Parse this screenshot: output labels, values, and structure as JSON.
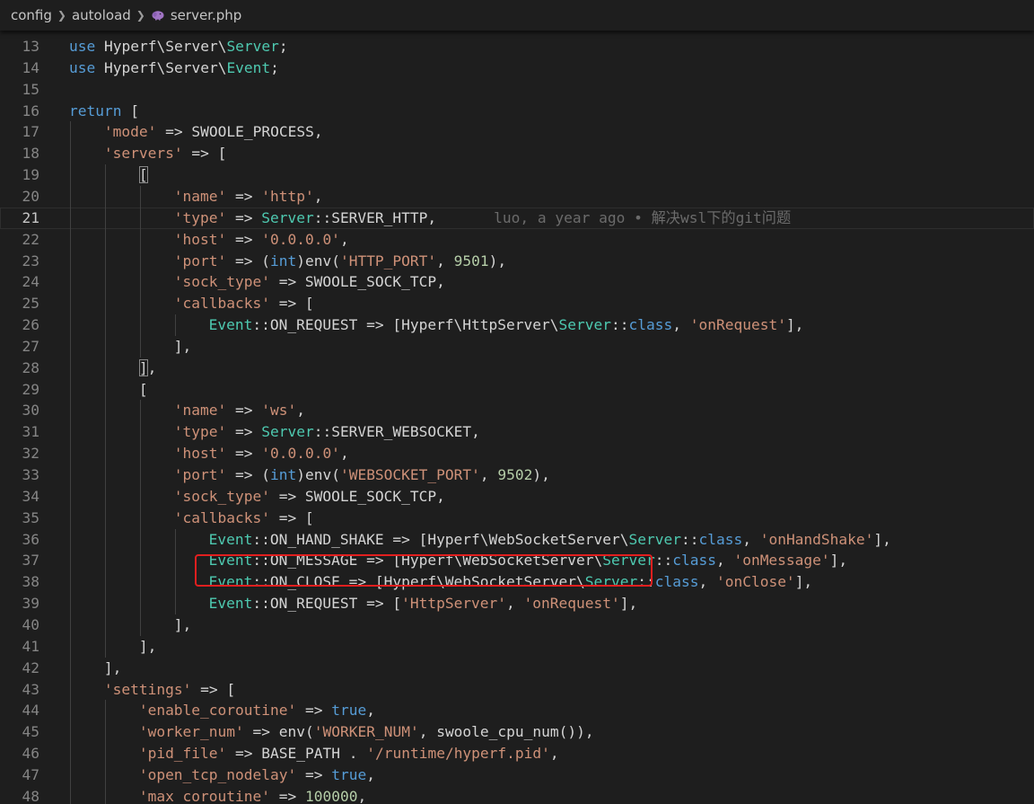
{
  "breadcrumb": {
    "items": [
      {
        "label": "config",
        "icon": null
      },
      {
        "label": "autoload",
        "icon": null
      },
      {
        "label": "server.php",
        "icon": "php-elephant-icon"
      }
    ],
    "separator_icon": "chevron-right-icon"
  },
  "colors": {
    "background": "#1e1e1e",
    "keyword": "#569cd6",
    "string": "#ce9178",
    "class": "#4ec9b0",
    "number": "#b5cea8",
    "plain": "#d4d4d4",
    "line_number": "#858585",
    "blame": "#6b6b6b",
    "annotation_box": "#e21f1f"
  },
  "editor": {
    "current_line": 21,
    "blame_annotation": {
      "line": 21,
      "text": "luo, a year ago • 解决wsl下的git问题"
    },
    "highlighted_line": 39,
    "lines": [
      {
        "n": "13",
        "indent": 0,
        "tokens": [
          [
            "kw",
            "use"
          ],
          [
            "p",
            " Hyperf\\Server\\"
          ],
          [
            "cls",
            "Server"
          ],
          [
            "p",
            ";"
          ]
        ]
      },
      {
        "n": "14",
        "indent": 0,
        "tokens": [
          [
            "kw",
            "use"
          ],
          [
            "p",
            " Hyperf\\Server\\"
          ],
          [
            "cls",
            "Event"
          ],
          [
            "p",
            ";"
          ]
        ]
      },
      {
        "n": "15",
        "indent": 0,
        "tokens": []
      },
      {
        "n": "16",
        "indent": 0,
        "tokens": [
          [
            "kw",
            "return"
          ],
          [
            "p",
            " ["
          ]
        ]
      },
      {
        "n": "17",
        "indent": 1,
        "tokens": [
          [
            "str",
            "'mode'"
          ],
          [
            "p",
            " => SWOOLE_PROCESS,"
          ]
        ]
      },
      {
        "n": "18",
        "indent": 1,
        "tokens": [
          [
            "str",
            "'servers'"
          ],
          [
            "p",
            " => ["
          ]
        ]
      },
      {
        "n": "19",
        "indent": 2,
        "tokens": [
          [
            "br",
            "["
          ]
        ]
      },
      {
        "n": "20",
        "indent": 3,
        "tokens": [
          [
            "str",
            "'name'"
          ],
          [
            "p",
            " => "
          ],
          [
            "str",
            "'http'"
          ],
          [
            "p",
            ","
          ]
        ]
      },
      {
        "n": "21",
        "indent": 3,
        "tokens": [
          [
            "str",
            "'type'"
          ],
          [
            "p",
            " => "
          ],
          [
            "cls",
            "Server"
          ],
          [
            "p",
            "::SERVER_HTTP,"
          ]
        ]
      },
      {
        "n": "22",
        "indent": 3,
        "tokens": [
          [
            "str",
            "'host'"
          ],
          [
            "p",
            " => "
          ],
          [
            "str",
            "'0.0.0.0'"
          ],
          [
            "p",
            ","
          ]
        ]
      },
      {
        "n": "23",
        "indent": 3,
        "tokens": [
          [
            "str",
            "'port'"
          ],
          [
            "p",
            " => ("
          ],
          [
            "kw",
            "int"
          ],
          [
            "p",
            ")env("
          ],
          [
            "str",
            "'HTTP_PORT'"
          ],
          [
            "p",
            ", "
          ],
          [
            "num",
            "9501"
          ],
          [
            "p",
            "),"
          ]
        ]
      },
      {
        "n": "24",
        "indent": 3,
        "tokens": [
          [
            "str",
            "'sock_type'"
          ],
          [
            "p",
            " => SWOOLE_SOCK_TCP,"
          ]
        ]
      },
      {
        "n": "25",
        "indent": 3,
        "tokens": [
          [
            "str",
            "'callbacks'"
          ],
          [
            "p",
            " => ["
          ]
        ]
      },
      {
        "n": "26",
        "indent": 4,
        "tokens": [
          [
            "cls",
            "Event"
          ],
          [
            "p",
            "::ON_REQUEST => [Hyperf\\HttpServer\\"
          ],
          [
            "cls",
            "Server"
          ],
          [
            "p",
            "::"
          ],
          [
            "kw",
            "class"
          ],
          [
            "p",
            ", "
          ],
          [
            "str",
            "'onRequest'"
          ],
          [
            "p",
            "],"
          ]
        ]
      },
      {
        "n": "27",
        "indent": 3,
        "tokens": [
          [
            "p",
            "],"
          ]
        ]
      },
      {
        "n": "28",
        "indent": 2,
        "tokens": [
          [
            "br",
            "]"
          ],
          [
            "p",
            ","
          ]
        ]
      },
      {
        "n": "29",
        "indent": 2,
        "tokens": [
          [
            "p",
            "["
          ]
        ]
      },
      {
        "n": "30",
        "indent": 3,
        "tokens": [
          [
            "str",
            "'name'"
          ],
          [
            "p",
            " => "
          ],
          [
            "str",
            "'ws'"
          ],
          [
            "p",
            ","
          ]
        ]
      },
      {
        "n": "31",
        "indent": 3,
        "tokens": [
          [
            "str",
            "'type'"
          ],
          [
            "p",
            " => "
          ],
          [
            "cls",
            "Server"
          ],
          [
            "p",
            "::SERVER_WEBSOCKET,"
          ]
        ]
      },
      {
        "n": "32",
        "indent": 3,
        "tokens": [
          [
            "str",
            "'host'"
          ],
          [
            "p",
            " => "
          ],
          [
            "str",
            "'0.0.0.0'"
          ],
          [
            "p",
            ","
          ]
        ]
      },
      {
        "n": "33",
        "indent": 3,
        "tokens": [
          [
            "str",
            "'port'"
          ],
          [
            "p",
            " => ("
          ],
          [
            "kw",
            "int"
          ],
          [
            "p",
            ")env("
          ],
          [
            "str",
            "'WEBSOCKET_PORT'"
          ],
          [
            "p",
            ", "
          ],
          [
            "num",
            "9502"
          ],
          [
            "p",
            "),"
          ]
        ]
      },
      {
        "n": "34",
        "indent": 3,
        "tokens": [
          [
            "str",
            "'sock_type'"
          ],
          [
            "p",
            " => SWOOLE_SOCK_TCP,"
          ]
        ]
      },
      {
        "n": "35",
        "indent": 3,
        "tokens": [
          [
            "str",
            "'callbacks'"
          ],
          [
            "p",
            " => ["
          ]
        ]
      },
      {
        "n": "36",
        "indent": 4,
        "tokens": [
          [
            "cls",
            "Event"
          ],
          [
            "p",
            "::ON_HAND_SHAKE => [Hyperf\\WebSocketServer\\"
          ],
          [
            "cls",
            "Server"
          ],
          [
            "p",
            "::"
          ],
          [
            "kw",
            "class"
          ],
          [
            "p",
            ", "
          ],
          [
            "str",
            "'onHandShake'"
          ],
          [
            "p",
            "],"
          ]
        ]
      },
      {
        "n": "37",
        "indent": 4,
        "tokens": [
          [
            "cls",
            "Event"
          ],
          [
            "p",
            "::ON_MESSAGE => [Hyperf\\WebSocketServer\\"
          ],
          [
            "cls",
            "Server"
          ],
          [
            "p",
            "::"
          ],
          [
            "kw",
            "class"
          ],
          [
            "p",
            ", "
          ],
          [
            "str",
            "'onMessage'"
          ],
          [
            "p",
            "],"
          ]
        ]
      },
      {
        "n": "38",
        "indent": 4,
        "tokens": [
          [
            "cls",
            "Event"
          ],
          [
            "p",
            "::ON_CLOSE => [Hyperf\\WebSocketServer\\"
          ],
          [
            "cls",
            "Server"
          ],
          [
            "p",
            "::"
          ],
          [
            "kw",
            "class"
          ],
          [
            "p",
            ", "
          ],
          [
            "str",
            "'onClose'"
          ],
          [
            "p",
            "],"
          ]
        ]
      },
      {
        "n": "39",
        "indent": 4,
        "tokens": [
          [
            "cls",
            "Event"
          ],
          [
            "p",
            "::ON_REQUEST => ["
          ],
          [
            "str",
            "'HttpServer'"
          ],
          [
            "p",
            ", "
          ],
          [
            "str",
            "'onRequest'"
          ],
          [
            "p",
            "],"
          ]
        ]
      },
      {
        "n": "40",
        "indent": 3,
        "tokens": [
          [
            "p",
            "],"
          ]
        ]
      },
      {
        "n": "41",
        "indent": 2,
        "tokens": [
          [
            "p",
            "],"
          ]
        ]
      },
      {
        "n": "42",
        "indent": 1,
        "tokens": [
          [
            "p",
            "],"
          ]
        ]
      },
      {
        "n": "43",
        "indent": 1,
        "tokens": [
          [
            "str",
            "'settings'"
          ],
          [
            "p",
            " => ["
          ]
        ]
      },
      {
        "n": "44",
        "indent": 2,
        "tokens": [
          [
            "str",
            "'enable_coroutine'"
          ],
          [
            "p",
            " => "
          ],
          [
            "kw",
            "true"
          ],
          [
            "p",
            ","
          ]
        ]
      },
      {
        "n": "45",
        "indent": 2,
        "tokens": [
          [
            "str",
            "'worker_num'"
          ],
          [
            "p",
            " => env("
          ],
          [
            "str",
            "'WORKER_NUM'"
          ],
          [
            "p",
            ", swoole_cpu_num()),"
          ]
        ]
      },
      {
        "n": "46",
        "indent": 2,
        "tokens": [
          [
            "str",
            "'pid_file'"
          ],
          [
            "p",
            " => BASE_PATH . "
          ],
          [
            "str",
            "'/runtime/hyperf.pid'"
          ],
          [
            "p",
            ","
          ]
        ]
      },
      {
        "n": "47",
        "indent": 2,
        "tokens": [
          [
            "str",
            "'open_tcp_nodelay'"
          ],
          [
            "p",
            " => "
          ],
          [
            "kw",
            "true"
          ],
          [
            "p",
            ","
          ]
        ]
      },
      {
        "n": "48",
        "indent": 2,
        "tokens": [
          [
            "str",
            "'max_coroutine'"
          ],
          [
            "p",
            " => "
          ],
          [
            "num",
            "100000"
          ],
          [
            "p",
            ","
          ]
        ]
      }
    ]
  }
}
